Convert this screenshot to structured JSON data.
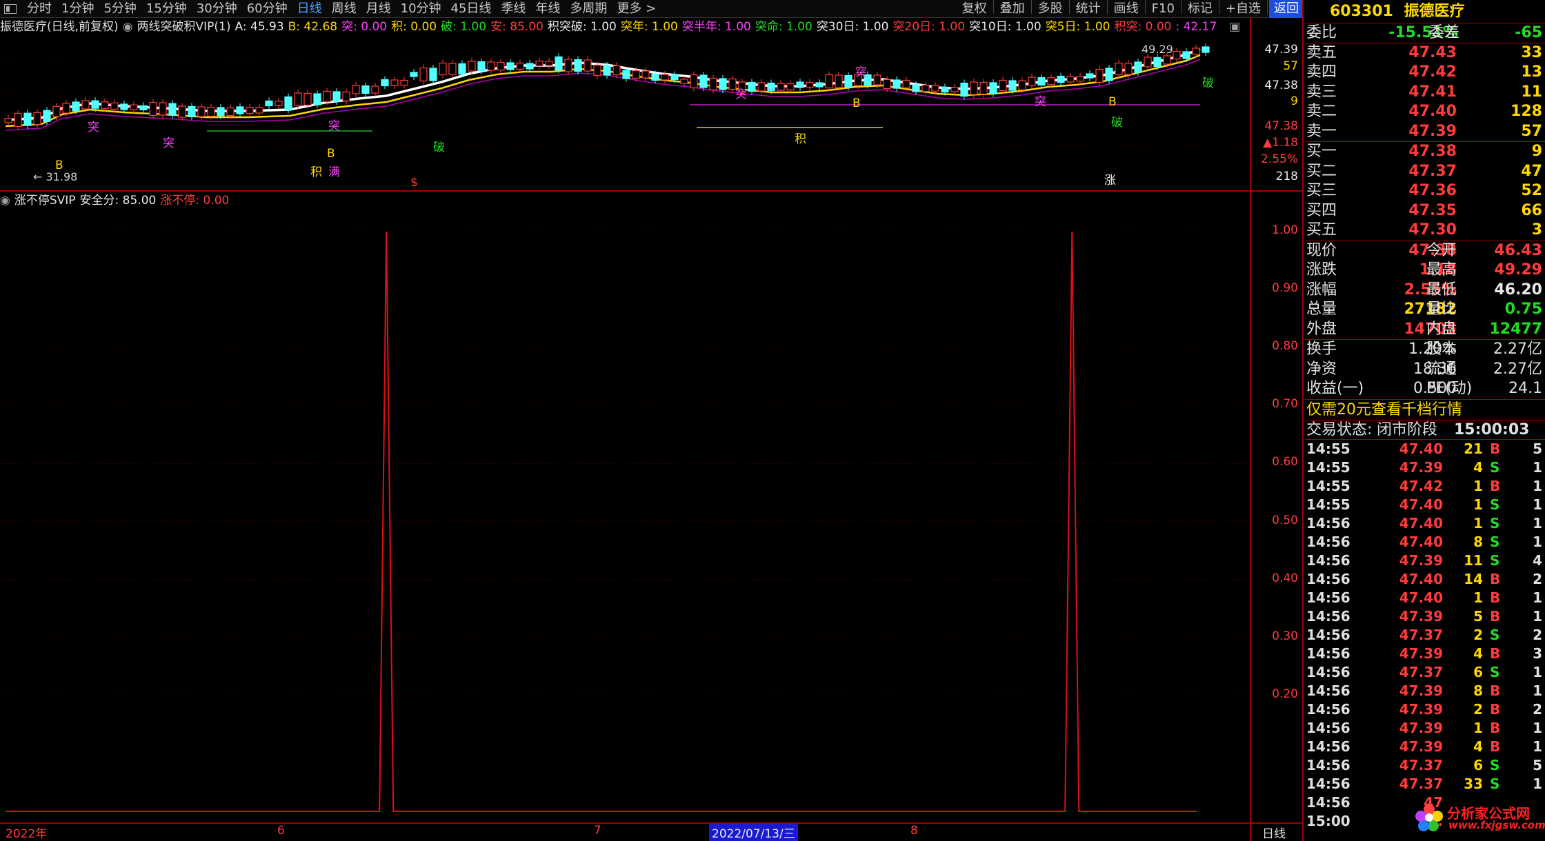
{
  "toolbar": {
    "periods": [
      "分时",
      "1分钟",
      "5分钟",
      "15分钟",
      "30分钟",
      "60分钟",
      "日线",
      "周线",
      "月线",
      "10分钟",
      "45日线",
      "季线",
      "年线",
      "多周期",
      "更多 >"
    ],
    "active_period": "日线",
    "actions": [
      "复权",
      "叠加",
      "多股",
      "统计",
      "画线",
      "F10",
      "标记",
      "+自选",
      "返回"
    ]
  },
  "info_main": {
    "stock_label": "振德医疗(日线,前复权)",
    "indicator": "两线突破积VIP(1)",
    "items": [
      {
        "text": "A: 45.93",
        "color": "white"
      },
      {
        "text": "B: 42.68",
        "color": "yellow"
      },
      {
        "text": "突: 0.00",
        "color": "magenta"
      },
      {
        "text": "积: 0.00",
        "color": "yellow"
      },
      {
        "text": "破: 1.00",
        "color": "green"
      },
      {
        "text": "安: 85.00",
        "color": "red"
      },
      {
        "text": "积突破: 1.00",
        "color": "white"
      },
      {
        "text": "突年: 1.00",
        "color": "yellow"
      },
      {
        "text": "突半年: 1.00",
        "color": "magenta"
      },
      {
        "text": "突命: 1.00",
        "color": "green"
      },
      {
        "text": "突30日: 1.00",
        "color": "white"
      },
      {
        "text": "突20日: 1.00",
        "color": "red"
      },
      {
        "text": "突10日: 1.00",
        "color": "white"
      },
      {
        "text": "突5日: 1.00",
        "color": "yellow"
      },
      {
        "text": "积突: 0.00",
        "color": "red"
      },
      {
        "text": ": 42.17",
        "color": "magenta"
      }
    ]
  },
  "info_sub": {
    "indicator": "涨不停SVIP",
    "items": [
      {
        "text": "安全分: 85.00",
        "color": "white"
      },
      {
        "text": "涨不停: 0.00",
        "color": "red"
      }
    ]
  },
  "upper_axis": {
    "labels": [
      {
        "text": "47.39",
        "color": "white",
        "y": 74
      },
      {
        "text": "57",
        "color": "yellow",
        "y": 98
      },
      {
        "text": "47.38",
        "color": "white",
        "y": 126
      },
      {
        "text": "9",
        "color": "yellow",
        "y": 149
      },
      {
        "text": "47.38",
        "color": "red",
        "y": 185
      },
      {
        "text": "▲1.18",
        "color": "red",
        "y": 209
      },
      {
        "text": "2.55%",
        "color": "red",
        "y": 233
      },
      {
        "text": "218",
        "color": "white",
        "y": 258
      }
    ]
  },
  "upper_annotations": {
    "high_price": "49.29",
    "low_price": "← 31.98",
    "signals": [
      {
        "text": "突",
        "color": "magenta",
        "x": 127,
        "y": 190
      },
      {
        "text": "突",
        "color": "magenta",
        "x": 236,
        "y": 213
      },
      {
        "text": "突",
        "color": "magenta",
        "x": 476,
        "y": 188
      },
      {
        "text": "B",
        "color": "yellow",
        "x": 80,
        "y": 245
      },
      {
        "text": "B",
        "color": "yellow",
        "x": 474,
        "y": 228
      },
      {
        "text": "积",
        "color": "yellow",
        "x": 450,
        "y": 255
      },
      {
        "text": "满",
        "color": "magenta",
        "x": 476,
        "y": 255
      },
      {
        "text": "破",
        "color": "green",
        "x": 628,
        "y": 219
      },
      {
        "text": "$",
        "color": "red",
        "x": 595,
        "y": 270
      },
      {
        "text": "突",
        "color": "magenta",
        "x": 1066,
        "y": 142
      },
      {
        "text": "积",
        "color": "yellow",
        "x": 1152,
        "y": 207
      },
      {
        "text": "突",
        "color": "magenta",
        "x": 1240,
        "y": 110
      },
      {
        "text": "B",
        "color": "yellow",
        "x": 1236,
        "y": 155
      },
      {
        "text": "突",
        "color": "magenta",
        "x": 1500,
        "y": 153
      },
      {
        "text": "B",
        "color": "yellow",
        "x": 1607,
        "y": 153
      },
      {
        "text": "破",
        "color": "green",
        "x": 1611,
        "y": 183
      },
      {
        "text": "涨",
        "color": "white",
        "x": 1601,
        "y": 267
      },
      {
        "text": "破",
        "color": "green",
        "x": 1743,
        "y": 126
      }
    ]
  },
  "chart_data": {
    "type": "line",
    "series": [
      {
        "values": [
          0,
          0,
          0,
          0,
          0,
          0,
          0,
          0,
          0,
          0,
          0,
          0,
          0,
          0,
          0,
          0,
          0,
          0,
          0,
          0,
          0,
          0,
          0,
          0,
          0,
          0,
          0,
          0,
          0,
          0,
          0,
          0,
          0,
          0,
          0,
          0,
          0,
          0,
          0,
          0,
          0,
          0,
          0,
          0,
          0,
          0,
          0,
          0,
          0,
          0,
          0,
          0,
          0,
          0,
          0,
          1,
          0,
          0,
          0,
          0,
          0,
          0,
          0,
          0,
          0,
          0,
          0,
          0,
          0,
          0,
          0,
          0,
          0,
          0,
          0,
          0,
          0,
          0,
          0,
          0,
          0,
          0,
          0,
          0,
          0,
          0,
          0,
          0,
          0,
          0,
          0,
          0,
          0,
          0,
          0,
          0,
          0,
          0,
          0,
          0,
          0,
          0,
          0,
          0,
          0,
          0,
          0,
          0,
          0,
          0,
          0,
          0,
          0,
          0,
          0,
          0,
          0,
          0,
          0,
          0,
          0,
          0,
          0,
          0,
          0,
          0,
          0,
          0,
          0,
          0,
          0,
          0,
          0,
          0,
          0,
          0,
          0,
          0,
          0,
          0,
          0,
          0,
          0,
          0,
          0,
          0,
          0,
          0,
          0,
          0,
          0,
          0,
          0,
          0,
          1,
          0,
          0,
          0,
          0,
          0,
          0,
          0,
          0,
          0,
          0,
          0,
          0,
          0,
          0,
          0,
          0,
          0,
          0
        ]
      }
    ],
    "ylim": [
      0,
      1.0
    ],
    "yticks": [
      "1.00",
      "0.90",
      "0.80",
      "0.70",
      "0.60",
      "0.50",
      "0.40",
      "0.30",
      "0.20"
    ],
    "grid": "horizontal"
  },
  "date_axis": {
    "labels": [
      {
        "text": "2022年",
        "x": 8
      },
      {
        "text": "6",
        "x": 402
      },
      {
        "text": "7",
        "x": 861
      },
      {
        "text": "8",
        "x": 1320
      }
    ],
    "cursor_date": "2022/07/13/三",
    "period_label": "日线"
  },
  "quote": {
    "code": "603301",
    "name": "振德医疗",
    "weibi_label": "委比",
    "weibi": "-15.51%",
    "weicha_label": "委差",
    "weicha": "-65",
    "sell": [
      {
        "label": "卖五",
        "price": "47.43",
        "vol": "33"
      },
      {
        "label": "卖四",
        "price": "47.42",
        "vol": "13"
      },
      {
        "label": "卖三",
        "price": "47.41",
        "vol": "11"
      },
      {
        "label": "卖二",
        "price": "47.40",
        "vol": "128"
      },
      {
        "label": "卖一",
        "price": "47.39",
        "vol": "57"
      }
    ],
    "buy": [
      {
        "label": "买一",
        "price": "47.38",
        "vol": "9"
      },
      {
        "label": "买二",
        "price": "47.37",
        "vol": "47"
      },
      {
        "label": "买三",
        "price": "47.36",
        "vol": "52"
      },
      {
        "label": "买四",
        "price": "47.35",
        "vol": "66"
      },
      {
        "label": "买五",
        "price": "47.30",
        "vol": "3"
      }
    ],
    "stats1": [
      {
        "l1": "现价",
        "v1": "47.38",
        "c1": "red",
        "l2": "今开",
        "v2": "46.43",
        "c2": "red"
      },
      {
        "l1": "涨跌",
        "v1": "1.18",
        "c1": "red",
        "l2": "最高",
        "v2": "49.29",
        "c2": "red"
      },
      {
        "l1": "涨幅",
        "v1": "2.55%",
        "c1": "red",
        "l2": "最低",
        "v2": "46.20",
        "c2": "white"
      },
      {
        "l1": "总量",
        "v1": "27182",
        "c1": "yellow",
        "l2": "量比",
        "v2": "0.75",
        "c2": "green"
      },
      {
        "l1": "外盘",
        "v1": "14705",
        "c1": "red",
        "l2": "内盘",
        "v2": "12477",
        "c2": "green"
      }
    ],
    "stats2": [
      {
        "l1": "换手",
        "v1": "1.20%",
        "l2": "股本",
        "v2": "2.27亿"
      },
      {
        "l1": "净资",
        "v1": "18.36",
        "l2": "流通",
        "v2": "2.27亿"
      },
      {
        "l1": "收益(一)",
        "v1": "0.500",
        "l2": "PE(动)",
        "v2": "24.1"
      }
    ],
    "promo": "仅需20元查看千档行情",
    "trade_status_label": "交易状态:",
    "trade_status": "闭市阶段",
    "trade_time": "15:00:03",
    "ticks": [
      {
        "t": "14:55",
        "p": "47.40",
        "v": "21",
        "d": "B",
        "n": "5"
      },
      {
        "t": "14:55",
        "p": "47.39",
        "v": "4",
        "d": "S",
        "n": "1"
      },
      {
        "t": "14:55",
        "p": "47.42",
        "v": "1",
        "d": "B",
        "n": "1"
      },
      {
        "t": "14:55",
        "p": "47.40",
        "v": "1",
        "d": "S",
        "n": "1"
      },
      {
        "t": "14:56",
        "p": "47.40",
        "v": "1",
        "d": "S",
        "n": "1"
      },
      {
        "t": "14:56",
        "p": "47.40",
        "v": "8",
        "d": "S",
        "n": "1"
      },
      {
        "t": "14:56",
        "p": "47.39",
        "v": "11",
        "d": "S",
        "n": "4"
      },
      {
        "t": "14:56",
        "p": "47.40",
        "v": "14",
        "d": "B",
        "n": "2"
      },
      {
        "t": "14:56",
        "p": "47.40",
        "v": "1",
        "d": "B",
        "n": "1"
      },
      {
        "t": "14:56",
        "p": "47.39",
        "v": "5",
        "d": "B",
        "n": "1"
      },
      {
        "t": "14:56",
        "p": "47.37",
        "v": "2",
        "d": "S",
        "n": "2"
      },
      {
        "t": "14:56",
        "p": "47.39",
        "v": "4",
        "d": "B",
        "n": "3"
      },
      {
        "t": "14:56",
        "p": "47.37",
        "v": "6",
        "d": "S",
        "n": "1"
      },
      {
        "t": "14:56",
        "p": "47.39",
        "v": "8",
        "d": "B",
        "n": "1"
      },
      {
        "t": "14:56",
        "p": "47.39",
        "v": "2",
        "d": "B",
        "n": "2"
      },
      {
        "t": "14:56",
        "p": "47.39",
        "v": "1",
        "d": "B",
        "n": "1"
      },
      {
        "t": "14:56",
        "p": "47.39",
        "v": "4",
        "d": "B",
        "n": "1"
      },
      {
        "t": "14:56",
        "p": "47.37",
        "v": "6",
        "d": "S",
        "n": "5"
      },
      {
        "t": "14:56",
        "p": "47.37",
        "v": "33",
        "d": "S",
        "n": "1"
      },
      {
        "t": "14:56",
        "p": "47",
        "v": "",
        "d": "",
        "n": ""
      },
      {
        "t": "15:00",
        "p": "47.",
        "v": "",
        "d": "",
        "n": ""
      }
    ]
  },
  "watermark": {
    "title": "分析家公式网",
    "url": "www.fxjgsw.com"
  },
  "colors": {
    "red": "#ff3c3c",
    "green": "#22dd22",
    "yellow": "#ffd700",
    "white": "#e8e8e8",
    "magenta": "#ff44ff",
    "cyan": "#40e0ff",
    "candle_up": "#ff3c3c",
    "candle_down": "#54ffff"
  }
}
